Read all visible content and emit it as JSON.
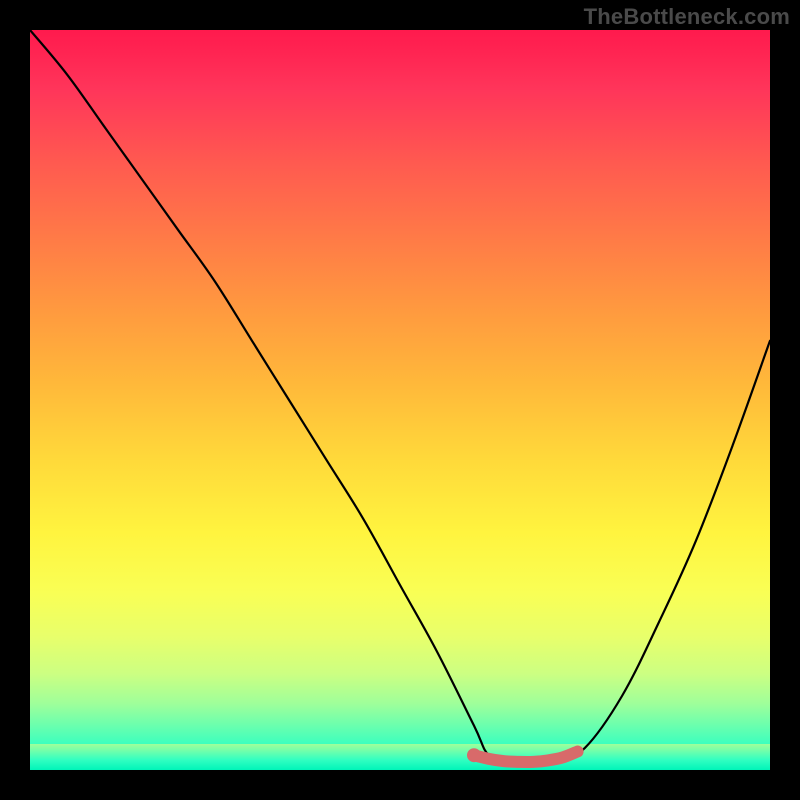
{
  "watermark": "TheBottleneck.com",
  "colors": {
    "frame": "#000000",
    "watermark_text": "#4a4a4a",
    "curve_stroke": "#000000",
    "marker_stroke": "#d86a6a",
    "gradient_top": "#ff1a4d",
    "gradient_bottom": "#00f5b9"
  },
  "chart_data": {
    "type": "line",
    "title": "",
    "xlabel": "",
    "ylabel": "",
    "xlim": [
      0,
      100
    ],
    "ylim": [
      0,
      100
    ],
    "grid": false,
    "legend": false,
    "background": "rainbow-gradient red-to-green top-to-bottom, y encodes bottleneck percentage (top=high, bottom=0)",
    "series": [
      {
        "name": "bottleneck-curve",
        "x": [
          0,
          5,
          10,
          15,
          20,
          25,
          30,
          35,
          40,
          45,
          50,
          55,
          60,
          62,
          65,
          68,
          72,
          75,
          80,
          85,
          90,
          95,
          100
        ],
        "y": [
          100,
          94,
          87,
          80,
          73,
          66,
          58,
          50,
          42,
          34,
          25,
          16,
          6,
          2,
          1,
          1,
          2,
          3,
          10,
          20,
          31,
          44,
          58
        ]
      },
      {
        "name": "optimal-range-marker",
        "x": [
          60,
          62,
          64,
          66,
          68,
          70,
          72,
          74
        ],
        "y": [
          2,
          1.5,
          1.2,
          1.1,
          1.1,
          1.3,
          1.7,
          2.5
        ]
      }
    ],
    "annotations": []
  }
}
